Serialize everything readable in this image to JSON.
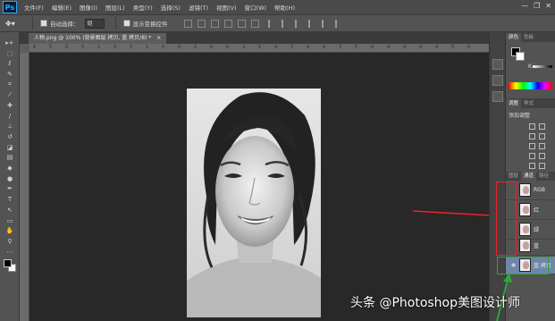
{
  "app": {
    "logo": "Ps"
  },
  "menu": [
    "文件(F)",
    "编辑(E)",
    "图像(I)",
    "图层(L)",
    "类型(Y)",
    "选择(S)",
    "滤镜(T)",
    "视图(V)",
    "窗口(W)",
    "帮助(H)"
  ],
  "window_controls": {
    "minimize": "—",
    "restore": "❐",
    "close": "✕"
  },
  "options": {
    "auto_select_label": "自动选择：",
    "auto_select_value": "组",
    "show_transform_label": "显示变换控件"
  },
  "document": {
    "tab_label": "人物.png @ 100% (背景图层 拷贝, 蓝 拷贝/8) *",
    "tab_close": "×"
  },
  "ruler_labels": {
    "top": [
      "8",
      "5",
      "0",
      "5",
      "1",
      "0",
      "0",
      "1",
      "5",
      "0",
      "2",
      "0",
      "0",
      "2",
      "5",
      "0",
      "3",
      "0",
      "0",
      "3",
      "5",
      "0",
      "4",
      "0",
      "0",
      "4",
      "5",
      "0"
    ]
  },
  "panels": {
    "color_tabs": [
      "颜色",
      "色板"
    ],
    "color_channel_label": "K",
    "adjust_tabs": [
      "调整",
      "样式"
    ],
    "adjust_title": "添加调整",
    "layers_tabs": [
      "图层",
      "通道",
      "路径"
    ],
    "channels": [
      {
        "name": "RGB"
      },
      {
        "name": "红"
      },
      {
        "name": "绿"
      },
      {
        "name": "蓝"
      },
      {
        "name": "蓝 拷贝",
        "selected": true,
        "visible": true
      }
    ]
  },
  "annotation_colors": {
    "red": "#e8232a",
    "green": "#2fa43a"
  },
  "watermark": "头条 @Photoshop美图设计师"
}
